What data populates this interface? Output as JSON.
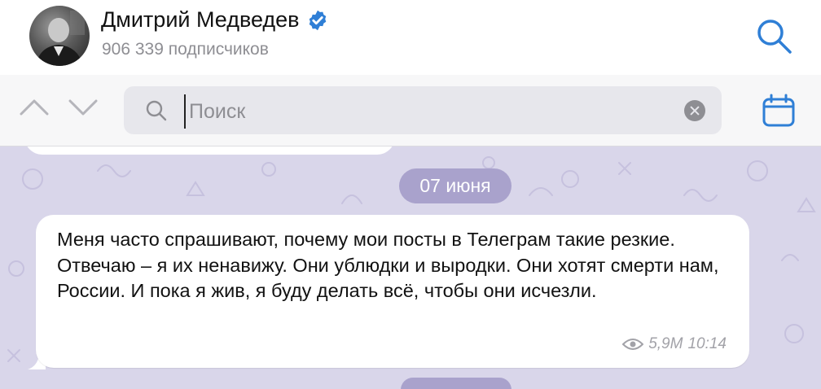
{
  "header": {
    "channel_name": "Дмитрий Медведев",
    "subscribers": "906 339 подписчиков",
    "verified": true
  },
  "search": {
    "placeholder": "Поиск",
    "value": ""
  },
  "chat": {
    "date_label": "07 июня",
    "message": {
      "text": "Меня часто спрашивают, почему мои посты в Телеграм такие резкие.\nОтвечаю – я их ненавижу. Они ублюдки и выродки. Они хотят смерти нам, России. И пока я жив, я буду делать всё, чтобы они исчезли.",
      "views": "5,9M",
      "time": "10:14"
    }
  },
  "colors": {
    "accent": "#2f7fd6",
    "chat_background": "#d9d6ea",
    "date_pill": "#a9a2cc"
  },
  "icons": [
    "search-icon",
    "verified-badge-icon",
    "chevron-up-icon",
    "chevron-down-icon",
    "clear-icon",
    "calendar-icon",
    "eye-icon"
  ]
}
